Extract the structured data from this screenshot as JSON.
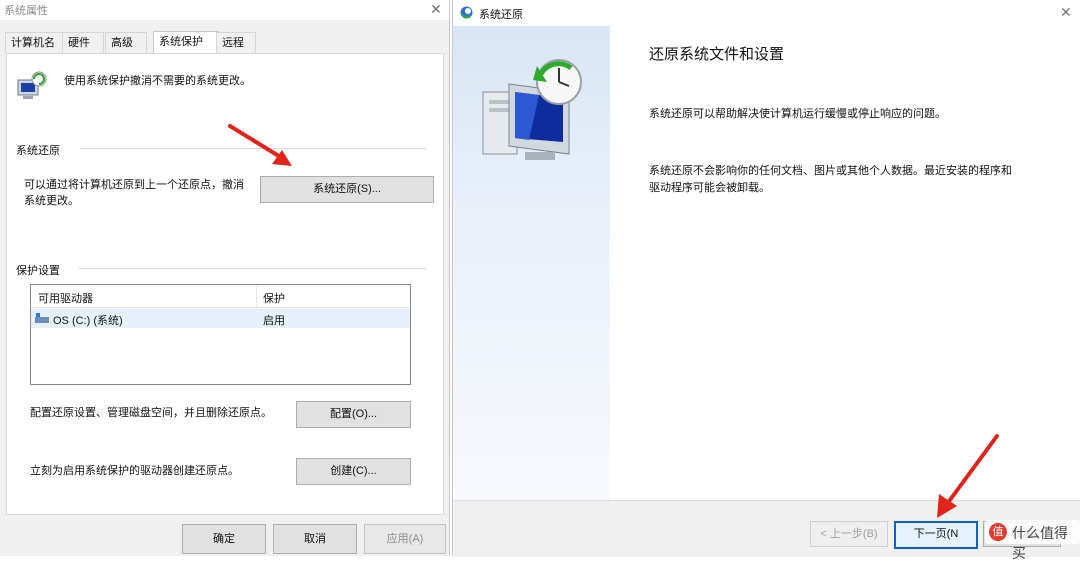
{
  "left_dialog": {
    "title": "系统属性",
    "tabs": [
      {
        "label": "计算机名"
      },
      {
        "label": "硬件"
      },
      {
        "label": "高级"
      },
      {
        "label": "系统保护"
      },
      {
        "label": "远程"
      }
    ],
    "intro_text": "使用系统保护撤消不需要的系统更改。",
    "restore_section": {
      "title": "系统还原",
      "description": "可以通过将计算机还原到上一个还原点，撤消系统更改。",
      "description_line1": "可以通过将计算机还原到上一个还原点，撤消",
      "description_line2": "系统更改。",
      "button_label": "系统还原(S)..."
    },
    "protection_section": {
      "title": "保护设置",
      "columns": [
        "可用驱动器",
        "保护"
      ],
      "rows": [
        {
          "drive": "OS (C:) (系统)",
          "protection": "启用"
        }
      ]
    },
    "configure": {
      "text": "配置还原设置、管理磁盘空间，并且删除还原点。",
      "button_label": "配置(O)..."
    },
    "create": {
      "text": "立刻为启用系统保护的驱动器创建还原点。",
      "button_label": "创建(C)..."
    },
    "footer": {
      "ok_label": "确定",
      "cancel_label": "取消",
      "apply_label": "应用(A)"
    }
  },
  "right_dialog": {
    "title": "系统还原",
    "heading": "还原系统文件和设置",
    "paragraph1": "系统还原可以帮助解决使计算机运行缓慢或停止响应的问题。",
    "paragraph2_line1": "系统还原不会影响你的任何文档、图片或其他个人数据。最近安装的程序和",
    "paragraph2_line2": "驱动程序可能会被卸载。",
    "back_label": "< 上一步(B)",
    "next_label": "下一页(N",
    "cancel_label": "取消"
  },
  "watermark": {
    "text": "什么值得买",
    "icon_text": "值"
  },
  "colors": {
    "annotation_arrow": "#e0231b",
    "accent_blue": "#0a61c9",
    "watermark_red": "#e13b2e"
  }
}
